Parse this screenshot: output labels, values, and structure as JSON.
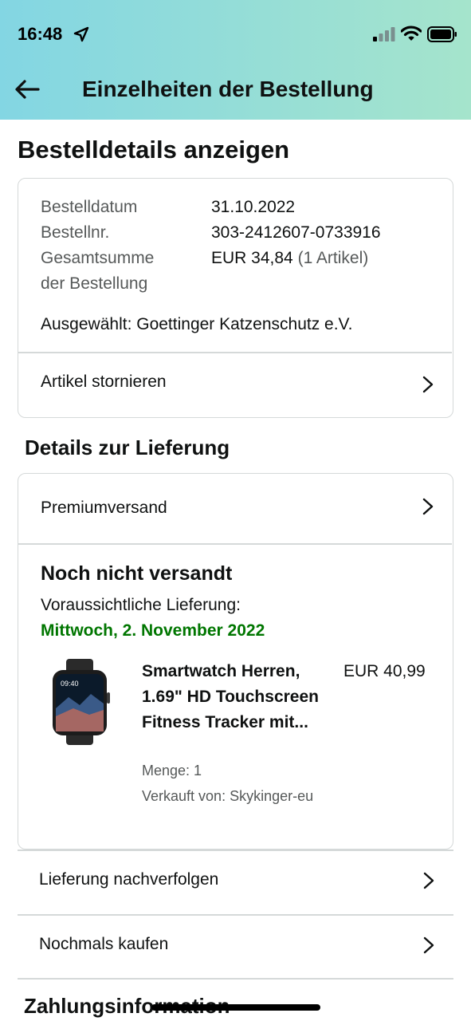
{
  "status_bar": {
    "time": "16:48"
  },
  "nav": {
    "title": "Einzelheiten der Bestellung"
  },
  "page": {
    "heading": "Bestelldetails anzeigen"
  },
  "order_summary": {
    "date_label": "Bestelldatum",
    "date_value": "31.10.2022",
    "number_label": "Bestellnr.",
    "number_value": "303-2412607-0733916",
    "total_label_line1": "Gesamtsumme",
    "total_label_line2": "der Bestellung",
    "total_value": "EUR 34,84",
    "total_items": "(1 Artikel)",
    "charity": "Ausgewählt: Goettinger Katzenschutz e.V.",
    "cancel_label": "Artikel stornieren"
  },
  "delivery": {
    "section_title": "Details zur Lieferung",
    "shipping_method": "Premiumversand",
    "status": "Noch nicht versandt",
    "expected_label": "Voraussichtliche Lieferung:",
    "expected_date": "Mittwoch, 2. November 2022",
    "product": {
      "title": "Smartwatch Herren, 1.69\" HD Touchscreen Fitness Tracker mit...",
      "price": "EUR 40,99",
      "quantity": "Menge: 1",
      "seller": "Verkauft von: Skykinger-eu",
      "watch_time": "09:40"
    }
  },
  "actions": {
    "track": "Lieferung nachverfolgen",
    "buy_again": "Nochmals kaufen"
  },
  "payment": {
    "heading": "Zahlungsinformation"
  },
  "colors": {
    "header_gradient_start": "#83d6e3",
    "header_gradient_end": "#a5e4cc",
    "delivery_date": "#007600",
    "muted_text": "#565959",
    "border": "#d5d9d9"
  }
}
